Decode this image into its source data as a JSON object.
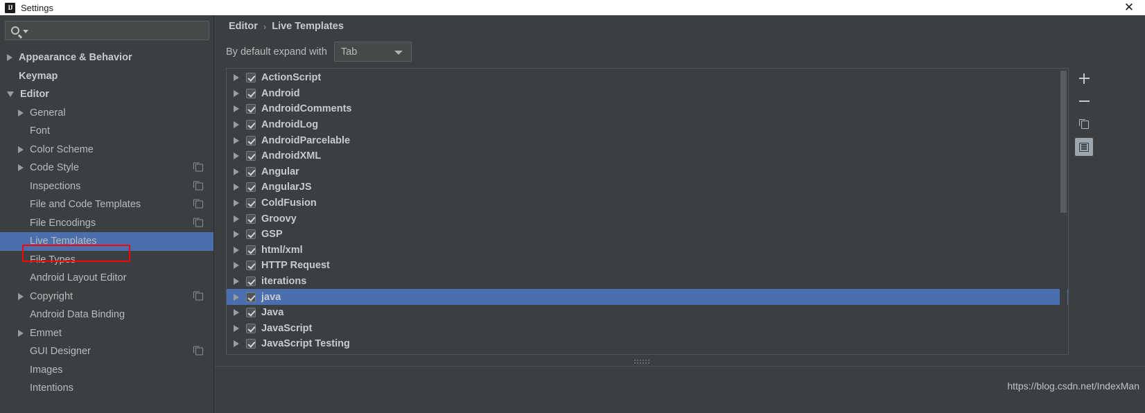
{
  "window": {
    "title": "Settings",
    "app_icon": "intellij-idea-icon",
    "close_label": "✕"
  },
  "sidebar": {
    "search": {
      "value": "",
      "placeholder": "",
      "icon": "search-icon",
      "dropdown_icon": "caret-down-icon"
    },
    "items": [
      {
        "label": "Appearance & Behavior",
        "arrow": "collapsed",
        "indent": 0,
        "bold": true,
        "copy": false,
        "selected": false
      },
      {
        "label": "Keymap",
        "arrow": "none",
        "indent": 0,
        "bold": true,
        "copy": false,
        "selected": false
      },
      {
        "label": "Editor",
        "arrow": "expanded",
        "indent": 0,
        "bold": true,
        "copy": false,
        "selected": false
      },
      {
        "label": "General",
        "arrow": "collapsed",
        "indent": 1,
        "bold": false,
        "copy": false,
        "selected": false
      },
      {
        "label": "Font",
        "arrow": "none",
        "indent": 1,
        "bold": false,
        "copy": false,
        "selected": false
      },
      {
        "label": "Color Scheme",
        "arrow": "collapsed",
        "indent": 1,
        "bold": false,
        "copy": false,
        "selected": false
      },
      {
        "label": "Code Style",
        "arrow": "collapsed",
        "indent": 1,
        "bold": false,
        "copy": true,
        "selected": false
      },
      {
        "label": "Inspections",
        "arrow": "none",
        "indent": 1,
        "bold": false,
        "copy": true,
        "selected": false
      },
      {
        "label": "File and Code Templates",
        "arrow": "none",
        "indent": 1,
        "bold": false,
        "copy": true,
        "selected": false
      },
      {
        "label": "File Encodings",
        "arrow": "none",
        "indent": 1,
        "bold": false,
        "copy": true,
        "selected": false
      },
      {
        "label": "Live Templates",
        "arrow": "none",
        "indent": 1,
        "bold": false,
        "copy": false,
        "selected": true
      },
      {
        "label": "File Types",
        "arrow": "none",
        "indent": 1,
        "bold": false,
        "copy": false,
        "selected": false
      },
      {
        "label": "Android Layout Editor",
        "arrow": "none",
        "indent": 1,
        "bold": false,
        "copy": false,
        "selected": false
      },
      {
        "label": "Copyright",
        "arrow": "collapsed",
        "indent": 1,
        "bold": false,
        "copy": true,
        "selected": false
      },
      {
        "label": "Android Data Binding",
        "arrow": "none",
        "indent": 1,
        "bold": false,
        "copy": false,
        "selected": false
      },
      {
        "label": "Emmet",
        "arrow": "collapsed",
        "indent": 1,
        "bold": false,
        "copy": false,
        "selected": false
      },
      {
        "label": "GUI Designer",
        "arrow": "none",
        "indent": 1,
        "bold": false,
        "copy": true,
        "selected": false
      },
      {
        "label": "Images",
        "arrow": "none",
        "indent": 1,
        "bold": false,
        "copy": false,
        "selected": false
      },
      {
        "label": "Intentions",
        "arrow": "none",
        "indent": 1,
        "bold": false,
        "copy": false,
        "selected": false
      }
    ]
  },
  "main": {
    "breadcrumb": {
      "parent": "Editor",
      "separator": "›",
      "current": "Live Templates"
    },
    "expand_with": {
      "label": "By default expand with",
      "value": "Tab",
      "arrow_icon": "chevron-down-icon"
    },
    "templates": [
      {
        "name": "ActionScript",
        "checked": true,
        "expanded": false,
        "selected": false
      },
      {
        "name": "Android",
        "checked": true,
        "expanded": false,
        "selected": false
      },
      {
        "name": "AndroidComments",
        "checked": true,
        "expanded": false,
        "selected": false
      },
      {
        "name": "AndroidLog",
        "checked": true,
        "expanded": false,
        "selected": false
      },
      {
        "name": "AndroidParcelable",
        "checked": true,
        "expanded": false,
        "selected": false
      },
      {
        "name": "AndroidXML",
        "checked": true,
        "expanded": false,
        "selected": false
      },
      {
        "name": "Angular",
        "checked": true,
        "expanded": false,
        "selected": false
      },
      {
        "name": "AngularJS",
        "checked": true,
        "expanded": false,
        "selected": false
      },
      {
        "name": "ColdFusion",
        "checked": true,
        "expanded": false,
        "selected": false
      },
      {
        "name": "Groovy",
        "checked": true,
        "expanded": false,
        "selected": false
      },
      {
        "name": "GSP",
        "checked": true,
        "expanded": false,
        "selected": false
      },
      {
        "name": "html/xml",
        "checked": true,
        "expanded": false,
        "selected": false
      },
      {
        "name": "HTTP Request",
        "checked": true,
        "expanded": false,
        "selected": false
      },
      {
        "name": "iterations",
        "checked": true,
        "expanded": false,
        "selected": false
      },
      {
        "name": "java",
        "checked": true,
        "expanded": false,
        "selected": true
      },
      {
        "name": "Java",
        "checked": true,
        "expanded": false,
        "selected": false
      },
      {
        "name": "JavaScript",
        "checked": true,
        "expanded": false,
        "selected": false
      },
      {
        "name": "JavaScript Testing",
        "checked": true,
        "expanded": false,
        "selected": false
      }
    ],
    "toolbar": [
      {
        "name": "add-button",
        "icon": "plus-icon",
        "active": false
      },
      {
        "name": "remove-button",
        "icon": "minus-icon",
        "active": false
      },
      {
        "name": "duplicate-button",
        "icon": "copy-icon",
        "active": false
      },
      {
        "name": "template-group-button",
        "icon": "list-icon",
        "active": true
      }
    ]
  },
  "watermark": {
    "text": "https://blog.csdn.net/IndexMan"
  },
  "colors": {
    "background": "#3c3f41",
    "selection": "#4b6eaf",
    "highlight_outline": "#fe0000",
    "text": "#bbbbbb",
    "titlebar": "#ffffff"
  }
}
